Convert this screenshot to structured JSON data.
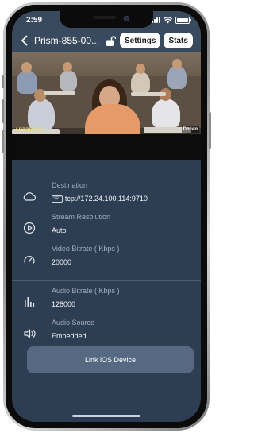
{
  "status_bar": {
    "time": "2:59"
  },
  "nav": {
    "title": "Prism-855-00...",
    "settings_label": "Settings",
    "stats_label": "Stats"
  },
  "video": {
    "logo_left": "ARTBEATS",
    "logo_right": "Docen"
  },
  "info": {
    "destination": {
      "label": "Destination",
      "protocol_tag": "SRT",
      "value": "tcp://172.24.100.114:9710"
    },
    "resolution": {
      "label": "Stream Resolution",
      "value": "Auto"
    },
    "video_bitrate": {
      "label": "Video Bitrate ( Kbps )",
      "value": "20000"
    },
    "audio_bitrate": {
      "label": "Audio Bitrate ( Kbps )",
      "value": "128000"
    },
    "audio_source": {
      "label": "Audio Source",
      "value": "Embedded"
    }
  },
  "actions": {
    "link_ios_label": "Link iOS Device"
  },
  "colors": {
    "background": "#2e3e52",
    "nav": "#3a4a5e",
    "button": "#556a82",
    "muted_text": "#9fb0c4"
  }
}
